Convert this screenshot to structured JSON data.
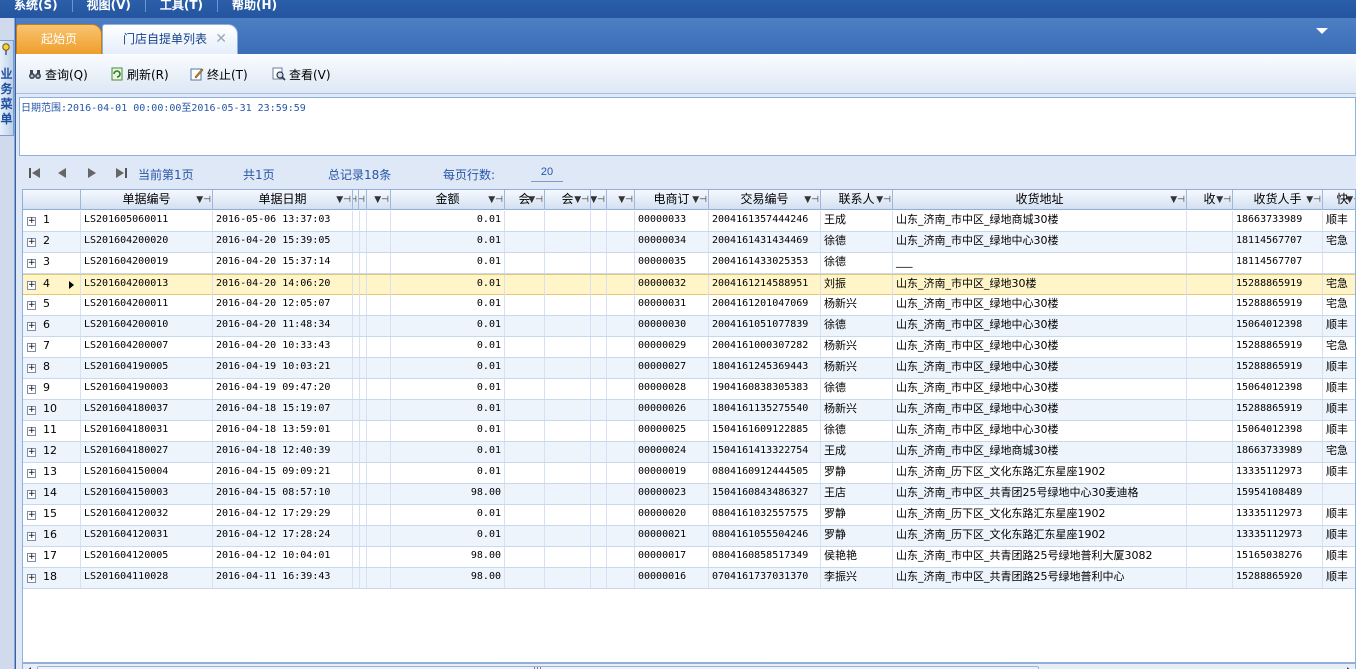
{
  "menubar": [
    {
      "label": "系统(S)"
    },
    {
      "label": "视图(V)"
    },
    {
      "label": "工具(T)"
    },
    {
      "label": "帮助(H)"
    }
  ],
  "sidebar": {
    "label": "业务菜单"
  },
  "tabs": {
    "home": "起始页",
    "active": "门店自提单列表",
    "close": "✕"
  },
  "toolbar": {
    "query": "查询(Q)",
    "refresh": "刷新(R)",
    "terminate": "终止(T)",
    "view": "查看(V)"
  },
  "filter": {
    "date_range": "日期范围:2016-04-01 00:00:00至2016-05-31 23:59:59"
  },
  "pager": {
    "current_page": "当前第1页",
    "total_pages": "共1页",
    "total_records": "总记录18条",
    "rows_per_page_label": "每页行数:",
    "rows_per_page": "20"
  },
  "grid": {
    "columns": [
      "单据编号",
      "单据日期",
      "金额",
      "会",
      "会",
      "电商订",
      "交易编号",
      "联系人",
      "收货地址",
      "收",
      "收货人手",
      "快"
    ],
    "rows": [
      {
        "n": "1",
        "id": "LS201605060011",
        "date": "2016-05-06 13:37:03",
        "amt": "0.01",
        "order": "00000033",
        "trade": "2004161357444246",
        "contact": "王成",
        "addr": "山东_济南_市中区_绿地商城30楼",
        "phone": "18663733989",
        "exp": "顺丰"
      },
      {
        "n": "2",
        "id": "LS201604200020",
        "date": "2016-04-20 15:39:05",
        "amt": "0.01",
        "order": "00000034",
        "trade": "2004161431434469",
        "contact": "徐德",
        "addr": "山东_济南_市中区_绿地中心30楼",
        "phone": "18114567707",
        "exp": "宅急"
      },
      {
        "n": "3",
        "id": "LS201604200019",
        "date": "2016-04-20 15:37:14",
        "amt": "0.01",
        "order": "00000035",
        "trade": "2004161433025353",
        "contact": "徐德",
        "addr": "___",
        "phone": "18114567707",
        "exp": ""
      },
      {
        "n": "4",
        "id": "LS201604200013",
        "date": "2016-04-20 14:06:20",
        "amt": "0.01",
        "order": "00000032",
        "trade": "2004161214588951",
        "contact": "刘振",
        "addr": "山东_济南_市中区_绿地30楼",
        "phone": "15288865919",
        "exp": "宅急"
      },
      {
        "n": "5",
        "id": "LS201604200011",
        "date": "2016-04-20 12:05:07",
        "amt": "0.01",
        "order": "00000031",
        "trade": "2004161201047069",
        "contact": "杨新兴",
        "addr": "山东_济南_市中区_绿地中心30楼",
        "phone": "15288865919",
        "exp": "宅急"
      },
      {
        "n": "6",
        "id": "LS201604200010",
        "date": "2016-04-20 11:48:34",
        "amt": "0.01",
        "order": "00000030",
        "trade": "2004161051077839",
        "contact": "徐德",
        "addr": "山东_济南_市中区_绿地中心30楼",
        "phone": "15064012398",
        "exp": "顺丰"
      },
      {
        "n": "7",
        "id": "LS201604200007",
        "date": "2016-04-20 10:33:43",
        "amt": "0.01",
        "order": "00000029",
        "trade": "2004161000307282",
        "contact": "杨新兴",
        "addr": "山东_济南_市中区_绿地中心30楼",
        "phone": "15288865919",
        "exp": "宅急"
      },
      {
        "n": "8",
        "id": "LS201604190005",
        "date": "2016-04-19 10:03:21",
        "amt": "0.01",
        "order": "00000027",
        "trade": "1804161245369443",
        "contact": "杨新兴",
        "addr": "山东_济南_市中区_绿地中心30楼",
        "phone": "15288865919",
        "exp": "顺丰"
      },
      {
        "n": "9",
        "id": "LS201604190003",
        "date": "2016-04-19 09:47:20",
        "amt": "0.01",
        "order": "00000028",
        "trade": "1904160838305383",
        "contact": "徐德",
        "addr": "山东_济南_市中区_绿地中心30楼",
        "phone": "15064012398",
        "exp": "顺丰"
      },
      {
        "n": "10",
        "id": "LS201604180037",
        "date": "2016-04-18 15:19:07",
        "amt": "0.01",
        "order": "00000026",
        "trade": "1804161135275540",
        "contact": "杨新兴",
        "addr": "山东_济南_市中区_绿地中心30楼",
        "phone": "15288865919",
        "exp": "顺丰"
      },
      {
        "n": "11",
        "id": "LS201604180031",
        "date": "2016-04-18 13:59:01",
        "amt": "0.01",
        "order": "00000025",
        "trade": "1504161609122885",
        "contact": "徐德",
        "addr": "山东_济南_市中区_绿地中心30楼",
        "phone": "15064012398",
        "exp": "顺丰"
      },
      {
        "n": "12",
        "id": "LS201604180027",
        "date": "2016-04-18 12:40:39",
        "amt": "0.01",
        "order": "00000024",
        "trade": "1504161413322754",
        "contact": "王成",
        "addr": "山东_济南_市中区_绿地商城30楼",
        "phone": "18663733989",
        "exp": "宅急"
      },
      {
        "n": "13",
        "id": "LS201604150004",
        "date": "2016-04-15 09:09:21",
        "amt": "0.01",
        "order": "00000019",
        "trade": "0804160912444505",
        "contact": "罗静",
        "addr": "山东_济南_历下区_文化东路汇东星座1902",
        "phone": "13335112973",
        "exp": "顺丰"
      },
      {
        "n": "14",
        "id": "LS201604150003",
        "date": "2016-04-15 08:57:10",
        "amt": "98.00",
        "order": "00000023",
        "trade": "1504160843486327",
        "contact": "王店",
        "addr": "山东_济南_市中区_共青团25号绿地中心30麦迪格",
        "phone": "15954108489",
        "exp": ""
      },
      {
        "n": "15",
        "id": "LS201604120032",
        "date": "2016-04-12 17:29:29",
        "amt": "0.01",
        "order": "00000020",
        "trade": "0804161032557575",
        "contact": "罗静",
        "addr": "山东_济南_历下区_文化东路汇东星座1902",
        "phone": "13335112973",
        "exp": "顺丰"
      },
      {
        "n": "16",
        "id": "LS201604120031",
        "date": "2016-04-12 17:28:24",
        "amt": "0.01",
        "order": "00000021",
        "trade": "0804161055504246",
        "contact": "罗静",
        "addr": "山东_济南_历下区_文化东路汇东星座1902",
        "phone": "13335112973",
        "exp": "顺丰"
      },
      {
        "n": "17",
        "id": "LS201604120005",
        "date": "2016-04-12 10:04:01",
        "amt": "98.00",
        "order": "00000017",
        "trade": "0804160858517349",
        "contact": "侯艳艳",
        "addr": "山东_济南_市中区_共青团路25号绿地普利大厦3082",
        "phone": "15165038276",
        "exp": "顺丰"
      },
      {
        "n": "18",
        "id": "LS201604110028",
        "date": "2016-04-11 16:39:43",
        "amt": "98.00",
        "order": "00000016",
        "trade": "0704161737031370",
        "contact": "李振兴",
        "addr": "山东_济南_市中区_共青团路25号绿地普利中心",
        "phone": "15288865920",
        "exp": "顺丰"
      }
    ],
    "selected_row": 3
  },
  "colors": {
    "accent": "#2656a8",
    "tab_home": "#ef9e2c",
    "selected_row": "#fff5c8"
  }
}
